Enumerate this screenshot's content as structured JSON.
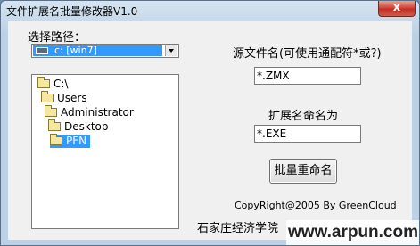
{
  "window": {
    "title": "文件扩展名批量修改器V1.0",
    "close_symbol": "x"
  },
  "path_section": {
    "label": "选择路径：",
    "drive_value": "c: [win7]"
  },
  "directory_tree": [
    {
      "label": "C:\\",
      "selected": false
    },
    {
      "label": "Users",
      "selected": false
    },
    {
      "label": "Administrator",
      "selected": false
    },
    {
      "label": "Desktop",
      "selected": false
    },
    {
      "label": "PFN",
      "selected": true
    }
  ],
  "source_ext": {
    "label": "源文件名(可使用通配符*或?)",
    "value": "*.ZMX"
  },
  "target_ext": {
    "label": "扩展名命名为",
    "value": "*.EXE"
  },
  "rename_button": {
    "label": "批量重命名"
  },
  "footer": {
    "copyright": "CopyRight@2005  By GreenCloud",
    "school": "石家庄经济学院"
  },
  "watermark": {
    "text": "www.arpun.com"
  },
  "colors": {
    "selection": "#3399ff",
    "title_bar": "#c7d9ea",
    "close_button": "#c9362a",
    "client_bg": "#f0f0f0"
  },
  "icons": {
    "drive": "drive-icon",
    "folder": "folder-icon",
    "combo_arrow": "chevron-down-icon"
  }
}
